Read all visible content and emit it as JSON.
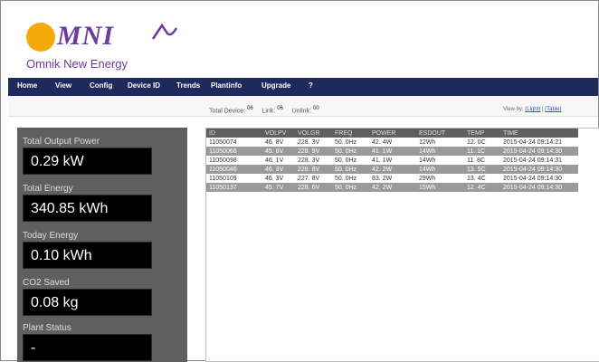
{
  "brand": {
    "logo_text": "MNI",
    "tagline": "Omnik New Energy",
    "accent": "#f5a90a",
    "brand_color": "#6b3b9e"
  },
  "nav": {
    "items": [
      "Home",
      "View",
      "Config",
      "Device ID",
      "Trends",
      "Plantinfo",
      "Upgrade",
      "?"
    ],
    "bar_color": "#1e2a5c"
  },
  "summary": {
    "total_devices_label": "Total Device:",
    "total_devices_value": "06",
    "link_label": "Link:",
    "link_value": "06",
    "unlink_label": "Unlink:",
    "unlink_value": "00",
    "view_by_label": "View by:",
    "view_by_option1": "(Light)",
    "view_by_sep": "|",
    "view_by_option2": "(Table)"
  },
  "metrics": [
    {
      "label": "Total Output Power",
      "value": "0.29 kW"
    },
    {
      "label": "Total Energy",
      "value": "340.85 kWh"
    },
    {
      "label": "Today Energy",
      "value": "0.10 kWh"
    },
    {
      "label": "CO2 Saved",
      "value": "0.08 kg"
    },
    {
      "label": "Plant Status",
      "value": "-"
    }
  ],
  "table": {
    "headers": [
      "ID",
      "VOLPV",
      "VOLGR",
      "FREQ",
      "POWER",
      "ESDOUT",
      "TEMP",
      "TIME"
    ],
    "rows": [
      [
        "11050074",
        "46. 8V",
        "228. 3V",
        "50. 0Hz",
        "42. 4W",
        "12Wh",
        "12. 0C",
        "2015-04-24 09:14:21"
      ],
      [
        "11050066",
        "45. 8V",
        "228. 9V",
        "50. 0Hz",
        "41. 1W",
        "14Wh",
        "11. 1C",
        "2015-04-24 09:14:30"
      ],
      [
        "11050098",
        "46. 1V",
        "228. 3V",
        "50. 0Hz",
        "41. 1W",
        "14Wh",
        "11. 8C",
        "2015-04-24 09:14:31"
      ],
      [
        "11050046",
        "46. 3V",
        "228. 8V",
        "50. 0Hz",
        "42. 2W",
        "14Wh",
        "13. 5C",
        "2015-04-24 09:14:30"
      ],
      [
        "11050109",
        "46. 3V",
        "227. 8V",
        "50. 0Hz",
        "83. 2W",
        "29Wh",
        "13. 4C",
        "2015-04-24 09:14:30"
      ],
      [
        "11050137",
        "45. 7V",
        "228. 6V",
        "50. 0Hz",
        "42. 2W",
        "15Wh",
        "12. 4C",
        "2015-04-24 09:14:30"
      ]
    ]
  }
}
